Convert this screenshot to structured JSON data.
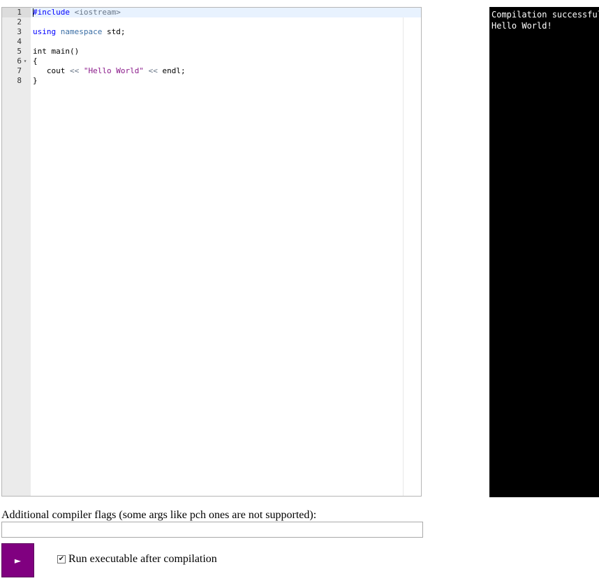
{
  "editor": {
    "lines": [
      {
        "num": "1",
        "fold": "",
        "tokens": [
          {
            "t": "#include",
            "c": "keyword"
          },
          {
            "t": " ",
            "c": "plain"
          },
          {
            "t": "<iostream>",
            "c": "operator"
          }
        ]
      },
      {
        "num": "2",
        "fold": "",
        "tokens": []
      },
      {
        "num": "3",
        "fold": "",
        "tokens": [
          {
            "t": "using",
            "c": "keyword"
          },
          {
            "t": " ",
            "c": "plain"
          },
          {
            "t": "namespace",
            "c": "storage"
          },
          {
            "t": " std;",
            "c": "plain"
          }
        ]
      },
      {
        "num": "4",
        "fold": "",
        "tokens": []
      },
      {
        "num": "5",
        "fold": "",
        "tokens": [
          {
            "t": "int main()",
            "c": "plain"
          }
        ]
      },
      {
        "num": "6",
        "fold": "▾",
        "tokens": [
          {
            "t": "{",
            "c": "plain"
          }
        ]
      },
      {
        "num": "7",
        "fold": "",
        "tokens": [
          {
            "t": "   cout ",
            "c": "plain"
          },
          {
            "t": "<<",
            "c": "operator"
          },
          {
            "t": " ",
            "c": "plain"
          },
          {
            "t": "\"Hello World\"",
            "c": "string"
          },
          {
            "t": " ",
            "c": "plain"
          },
          {
            "t": "<<",
            "c": "operator"
          },
          {
            "t": " endl;",
            "c": "plain"
          }
        ]
      },
      {
        "num": "8",
        "fold": "",
        "tokens": [
          {
            "t": "}",
            "c": "plain"
          }
        ]
      }
    ],
    "active_line": 1
  },
  "console": {
    "output": "Compilation successful\nHello World!"
  },
  "flags": {
    "label": "Additional compiler flags (some args like pch ones are not supported):",
    "value": "",
    "placeholder": ""
  },
  "run_button": {
    "icon": "play-icon",
    "symbol": "►",
    "color": "#800080"
  },
  "run_option": {
    "label": "Run executable after compilation",
    "checked": true,
    "check_symbol": "✔"
  }
}
